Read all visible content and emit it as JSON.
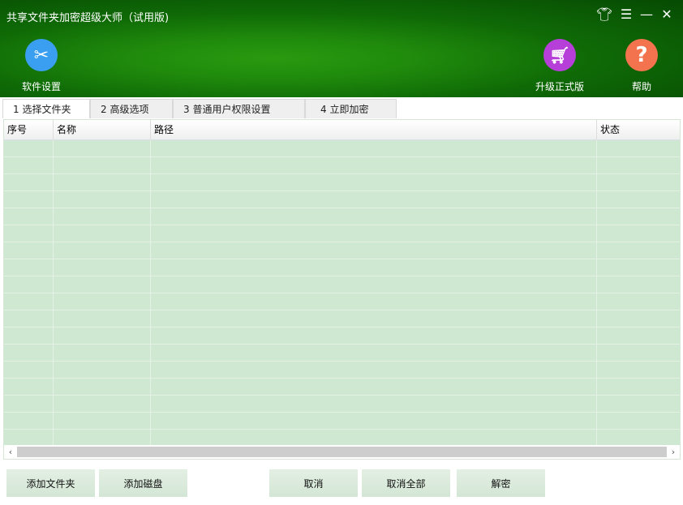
{
  "window": {
    "title": "共享文件夹加密超级大师（试用版)",
    "controls": [
      "skin-icon",
      "menu-icon",
      "minimize-icon",
      "close-icon"
    ]
  },
  "toolbar": {
    "settings": "软件设置",
    "upgrade": "升级正式版",
    "help": "帮助"
  },
  "tabs": [
    "1 选择文件夹",
    "2 高级选项",
    "3 普通用户权限设置",
    "4 立即加密"
  ],
  "table": {
    "columns": [
      "序号",
      "名称",
      "路径",
      "状态"
    ],
    "rows": []
  },
  "buttons": {
    "add_folder": "添加文件夹",
    "add_disk": "添加磁盘",
    "cancel": "取消",
    "cancel_all": "取消全部",
    "decrypt": "解密"
  },
  "colors": {
    "settings": "#3a9ff0",
    "upgrade": "#b53fd8",
    "help": "#f2734e"
  }
}
